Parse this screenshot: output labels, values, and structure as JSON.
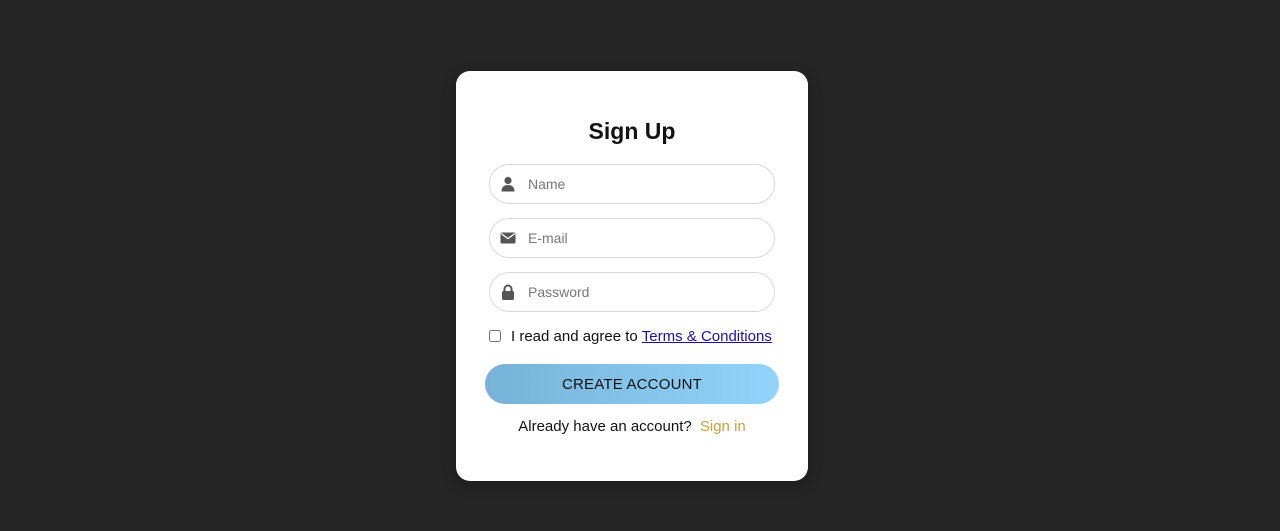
{
  "signup": {
    "title": "Sign Up",
    "fields": {
      "name": {
        "placeholder": "Name",
        "value": "",
        "icon": "user-icon"
      },
      "email": {
        "placeholder": "E-mail",
        "value": "",
        "icon": "envelope-icon"
      },
      "password": {
        "placeholder": "Password",
        "value": "",
        "icon": "lock-icon"
      }
    },
    "terms": {
      "checked": false,
      "text": "I read and agree to",
      "link_label": "Terms & Conditions"
    },
    "create_button_label": "CREATE ACCOUNT",
    "signin": {
      "prompt": "Already have an account?",
      "link_label": "Sign in"
    }
  },
  "colors": {
    "background": "#252525",
    "card": "#ffffff",
    "button_gradient_start": "#77b2d8",
    "button_gradient_end": "#92d4fb",
    "terms_link": "#1a0dab",
    "signin_link": "#c9a03c",
    "icon": "#555555"
  }
}
